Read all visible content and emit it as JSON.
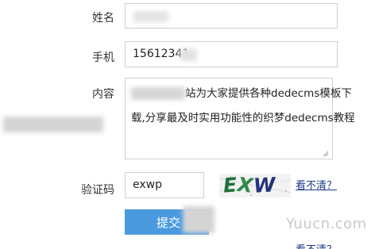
{
  "form": {
    "name_label": "姓名",
    "phone_label": "手机",
    "phone_value": "15612341",
    "content_label": "内容",
    "content_line1": "站为大家提供各种dedecms模板下",
    "content_line2": "载,分享最及时实用功能性的织梦dedecms教程",
    "captcha_label": "验证码",
    "captcha_value": "exwp",
    "captcha_image_text": "EXWP",
    "refresh_link": "看不清？",
    "refresh_link_dup": "看不清？",
    "submit_label": "提交"
  },
  "watermark": "Yuucn.com",
  "colors": {
    "submit_bg": "#4b9ae0",
    "link": "#1a3b8a",
    "captcha_E": "#1f6f3a",
    "captcha_X": "#2f8a4a",
    "captcha_W": "#23327a",
    "captcha_P": "#2a6fd1"
  }
}
